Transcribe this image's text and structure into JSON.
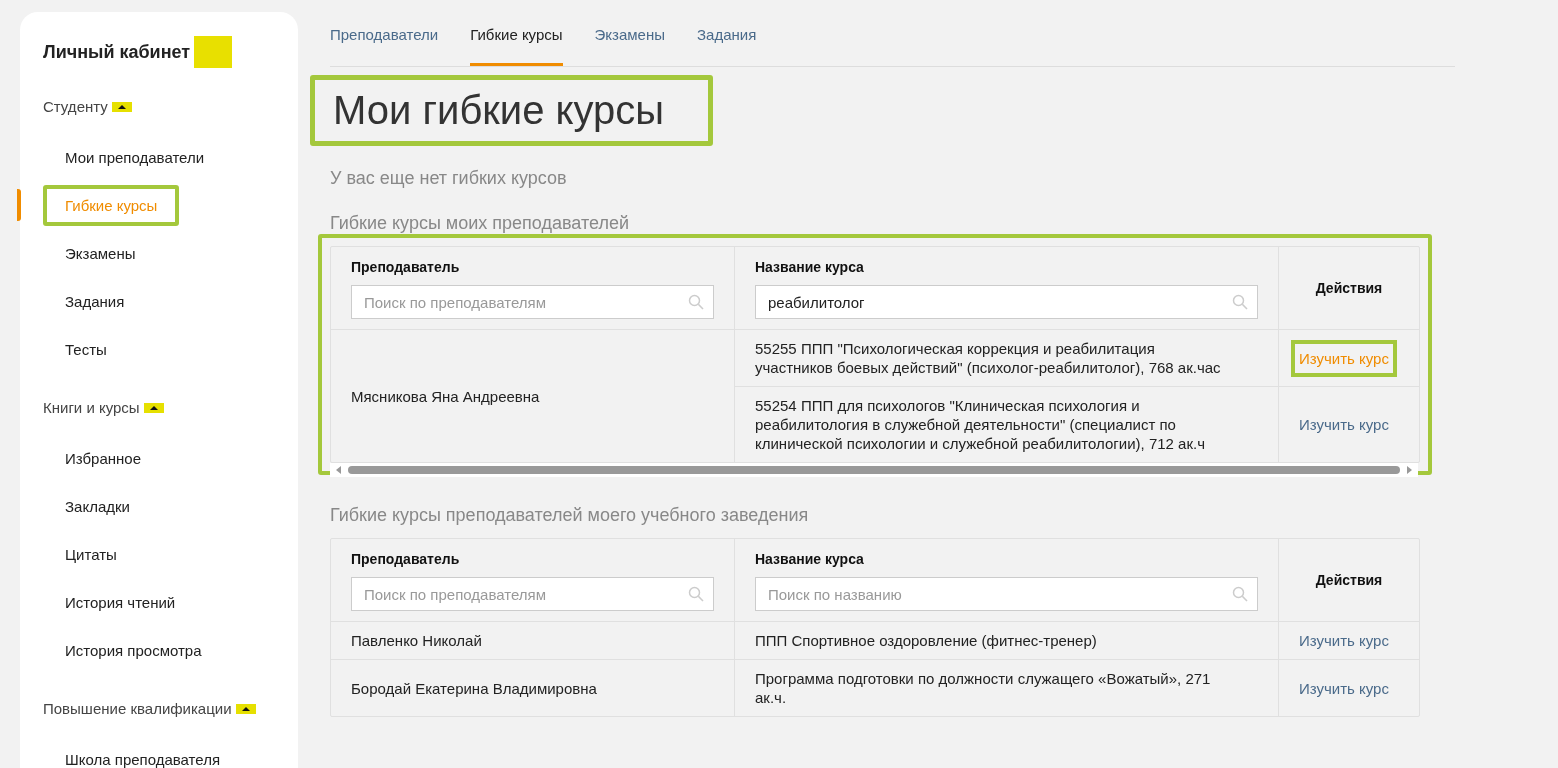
{
  "sidebar": {
    "title": "Личный кабинет",
    "sections": [
      {
        "heading": "Студенту",
        "items": [
          {
            "label": "Мои преподаватели",
            "selected": false,
            "highlighted": false
          },
          {
            "label": "Гибкие курсы",
            "selected": true,
            "highlighted": true
          },
          {
            "label": "Экзамены",
            "selected": false,
            "highlighted": false
          },
          {
            "label": "Задания",
            "selected": false,
            "highlighted": false
          },
          {
            "label": "Тесты",
            "selected": false,
            "highlighted": false
          }
        ]
      },
      {
        "heading": "Книги и курсы",
        "items": [
          {
            "label": "Избранное",
            "selected": false,
            "highlighted": false
          },
          {
            "label": "Закладки",
            "selected": false,
            "highlighted": false
          },
          {
            "label": "Цитаты",
            "selected": false,
            "highlighted": false
          },
          {
            "label": "История чтений",
            "selected": false,
            "highlighted": false
          },
          {
            "label": "История просмотра",
            "selected": false,
            "highlighted": false
          }
        ]
      },
      {
        "heading": "Повышение квалификации",
        "items": [
          {
            "label": "Школа преподавателя",
            "selected": false,
            "highlighted": false
          }
        ]
      }
    ]
  },
  "tabs": [
    {
      "label": "Преподаватели",
      "selected": false
    },
    {
      "label": "Гибкие курсы",
      "selected": true
    },
    {
      "label": "Экзамены",
      "selected": false
    },
    {
      "label": "Задания",
      "selected": false
    }
  ],
  "title": {
    "text": "Мои гибкие курсы",
    "highlighted": true
  },
  "empty_message": "У вас еще нет гибких курсов",
  "sections": [
    {
      "heading": "Гибкие курсы моих преподавателей",
      "highlighted": true,
      "scrollbar": true,
      "columns": [
        {
          "label": "Преподаватель",
          "search": {
            "placeholder": "Поиск по преподавателям"
          }
        },
        {
          "label": "Название курса",
          "search": {
            "value": "реабилитолог"
          }
        }
      ],
      "actions_header": "Действия",
      "groups": [
        {
          "teacher": "Мясникова Яна Андреевна",
          "courses": [
            {
              "title": "55255 ППП \"Психологическая коррекция и реабилитация участников боевых действий\" (психолог-реабилитолог), 768 ак.час",
              "action": "Изучить курс",
              "highlighted": true
            },
            {
              "title": "55254 ППП для психологов \"Клиническая психология и реабилитология в служебной деятельности\" (специалист по клинической психологии и служебной реабилитологии), 712 ак.ч",
              "action": "Изучить курс",
              "highlighted": false
            }
          ]
        }
      ]
    },
    {
      "heading": "Гибкие курсы преподавателей моего учебного заведения",
      "highlighted": false,
      "scrollbar": false,
      "columns": [
        {
          "label": "Преподаватель",
          "search": {
            "placeholder": "Поиск по преподавателям"
          }
        },
        {
          "label": "Название курса",
          "search": {
            "placeholder": "Поиск по названию"
          }
        }
      ],
      "actions_header": "Действия",
      "groups": [
        {
          "teacher": "Павленко Николай",
          "courses": [
            {
              "title": "ППП Спортивное оздоровление (фитнес-тренер)",
              "action": "Изучить курс",
              "highlighted": false
            }
          ]
        },
        {
          "teacher": "Бородай Екатерина Владимировна",
          "courses": [
            {
              "title": "Программа подготовки по должности служащего «Вожатый», 271 ак.ч.",
              "action": "Изучить курс",
              "highlighted": false
            }
          ]
        }
      ]
    }
  ]
}
